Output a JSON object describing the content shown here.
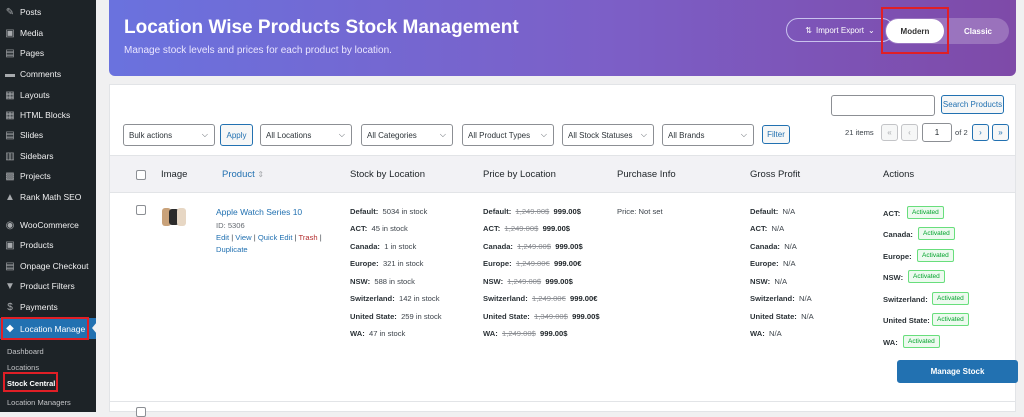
{
  "sidebar": {
    "items": [
      {
        "label": "Posts",
        "icon": "pin-icon"
      },
      {
        "label": "Media",
        "icon": "media-icon"
      },
      {
        "label": "Pages",
        "icon": "pages-icon"
      },
      {
        "label": "Comments",
        "icon": "comment-icon"
      },
      {
        "label": "Layouts",
        "icon": "layout-icon"
      },
      {
        "label": "HTML Blocks",
        "icon": "blocks-icon"
      },
      {
        "label": "Slides",
        "icon": "slides-icon"
      },
      {
        "label": "Sidebars",
        "icon": "sidebar-icon"
      },
      {
        "label": "Projects",
        "icon": "projects-icon"
      },
      {
        "label": "Rank Math SEO",
        "icon": "chart-icon"
      },
      {
        "label": "WooCommerce",
        "icon": "woo-icon"
      },
      {
        "label": "Products",
        "icon": "products-icon"
      },
      {
        "label": "Onpage Checkout",
        "icon": "checkout-icon"
      },
      {
        "label": "Product Filters",
        "icon": "filter-icon"
      },
      {
        "label": "Payments",
        "icon": "dollar-icon"
      },
      {
        "label": "Location Manage",
        "icon": "location-icon"
      }
    ],
    "submenu": [
      "Dashboard",
      "Locations",
      "Stock Central",
      "Location Managers"
    ]
  },
  "header": {
    "title": "Location Wise Products Stock Management",
    "subtitle": "Manage stock levels and prices for each product by location.",
    "import_export": "Import Export",
    "view_modern": "Modern",
    "view_classic": "Classic"
  },
  "toolbar": {
    "search_button": "Search Products",
    "bulk_actions": "Bulk actions",
    "apply": "Apply",
    "locations": "All Locations",
    "categories": "All Categories",
    "product_types": "All Product Types",
    "stock_statuses": "All Stock Statuses",
    "brands": "All Brands",
    "filter": "Filter",
    "items_count": "21 items",
    "page_current": "1",
    "page_total": "of 2",
    "first": "«",
    "prev": "‹",
    "next": "›",
    "last": "»"
  },
  "table": {
    "headers": [
      "Image",
      "Product",
      "Stock by Location",
      "Price by Location",
      "Purchase Info",
      "Gross Profit",
      "Actions"
    ],
    "sort_icon": "⇕",
    "row": {
      "name": "Apple Watch Series 10",
      "id": "ID: 5306",
      "edit": "Edit",
      "view": "View",
      "quick_edit": "Quick Edit",
      "trash": "Trash",
      "duplicate": "Duplicate",
      "stock": [
        {
          "loc": "Default:",
          "val": "5034 in stock"
        },
        {
          "loc": "ACT:",
          "val": "45 in stock"
        },
        {
          "loc": "Canada:",
          "val": "1 in stock"
        },
        {
          "loc": "Europe:",
          "val": "321 in stock"
        },
        {
          "loc": "NSW:",
          "val": "588 in stock"
        },
        {
          "loc": "Switzerland:",
          "val": "142 in stock"
        },
        {
          "loc": "United State:",
          "val": "259 in stock"
        },
        {
          "loc": "WA:",
          "val": "47 in stock"
        }
      ],
      "prices": [
        {
          "loc": "Default:",
          "old": "1,249.00$",
          "new": "999.00$"
        },
        {
          "loc": "ACT:",
          "old": "1,249.00$",
          "new": "999.00$"
        },
        {
          "loc": "Canada:",
          "old": "1,249.00$",
          "new": "999.00$"
        },
        {
          "loc": "Europe:",
          "old": "1,249.00€",
          "new": "999.00€"
        },
        {
          "loc": "NSW:",
          "old": "1,249.00$",
          "new": "999.00$"
        },
        {
          "loc": "Switzerland:",
          "old": "1,249.00€",
          "new": "999.00€"
        },
        {
          "loc": "United State:",
          "old": "1,349.00$",
          "new": "999.00$"
        },
        {
          "loc": "WA:",
          "old": "1,249.00$",
          "new": "999.00$"
        }
      ],
      "purchase": "Price: Not set",
      "profit": [
        {
          "loc": "Default:",
          "val": "N/A"
        },
        {
          "loc": "ACT:",
          "val": "N/A"
        },
        {
          "loc": "Canada:",
          "val": "N/A"
        },
        {
          "loc": "Europe:",
          "val": "N/A"
        },
        {
          "loc": "NSW:",
          "val": "N/A"
        },
        {
          "loc": "Switzerland:",
          "val": "N/A"
        },
        {
          "loc": "United State:",
          "val": "N/A"
        },
        {
          "loc": "WA:",
          "val": "N/A"
        }
      ],
      "actions": [
        {
          "loc": "ACT:",
          "status": "Activated"
        },
        {
          "loc": "Canada:",
          "status": "Activated"
        },
        {
          "loc": "Europe:",
          "status": "Activated"
        },
        {
          "loc": "NSW:",
          "status": "Activated"
        },
        {
          "loc": "Switzerland:",
          "status": "Activated"
        },
        {
          "loc": "United State:",
          "status": "Activated"
        },
        {
          "loc": "WA:",
          "status": "Activated"
        }
      ],
      "manage_stock": "Manage Stock"
    }
  },
  "colors": {
    "accent": "#2271b1",
    "highlight": "#e01f26",
    "badge": "#00a32a",
    "header_start": "#6a72de",
    "header_end": "#7e4aa8"
  }
}
